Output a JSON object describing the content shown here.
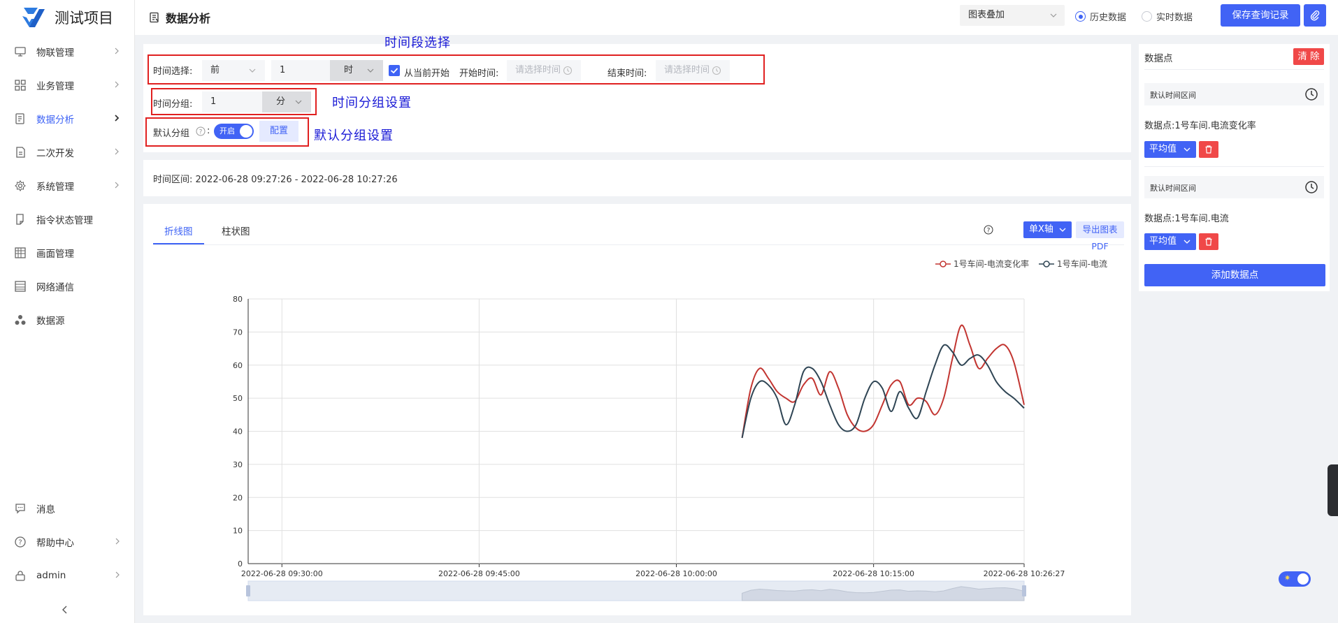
{
  "app": {
    "title": "测试项目"
  },
  "sidebar": {
    "items": [
      {
        "label": "物联管理",
        "icon": "monitor-icon"
      },
      {
        "label": "业务管理",
        "icon": "grid-icon"
      },
      {
        "label": "数据分析",
        "icon": "analysis-icon"
      },
      {
        "label": "二次开发",
        "icon": "dev-icon"
      },
      {
        "label": "系统管理",
        "icon": "gear-icon"
      },
      {
        "label": "指令状态管理",
        "icon": "command-icon"
      },
      {
        "label": "画面管理",
        "icon": "screen-icon"
      },
      {
        "label": "网络通信",
        "icon": "network-icon"
      },
      {
        "label": "数据源",
        "icon": "datasource-icon"
      }
    ],
    "bottom": [
      {
        "label": "消息",
        "icon": "message-icon"
      },
      {
        "label": "帮助中心",
        "icon": "help-icon"
      },
      {
        "label": "admin",
        "icon": "user-icon"
      }
    ]
  },
  "header": {
    "title": "数据分析",
    "overlay_select": "图表叠加",
    "radio_history": "历史数据",
    "radio_realtime": "实时数据",
    "save_button": "保存查询记录"
  },
  "filter": {
    "time_select_label": "时间选择:",
    "direction": "前",
    "amount": "1",
    "unit": "时",
    "from_now_label": "从当前开始",
    "start_label": "开始时间:",
    "start_placeholder": "请选择时间",
    "end_label": "结束时间:",
    "end_placeholder": "请选择时间",
    "group_label": "时间分组:",
    "group_amount": "1",
    "group_unit": "分",
    "default_group_label": "默认分组",
    "default_group_colon": ":",
    "toggle_label": "开启",
    "config_button": "配置"
  },
  "annotations": {
    "range": "时间段选择",
    "group": "时间分组设置",
    "default_group": "默认分组设置"
  },
  "range": {
    "label": "时间区间:",
    "value": "2022-06-28 09:27:26 - 2022-06-28 10:27:26"
  },
  "chart_panel": {
    "tab_line": "折线图",
    "tab_bar": "柱状图",
    "axis_button": "单X轴",
    "export_button": "导出图表PDF"
  },
  "chart_data": {
    "type": "line",
    "series": [
      {
        "name": "1号车间-电流变化率",
        "color": "#c23531",
        "x": [
          "10:05",
          "10:05:40",
          "10:06:20",
          "10:07",
          "10:07:40",
          "10:08:20",
          "10:09",
          "10:09:40",
          "10:10:20",
          "10:11",
          "10:11:40",
          "10:12:20",
          "10:13",
          "10:13:40",
          "10:14:20",
          "10:15",
          "10:15:40",
          "10:16:20",
          "10:17",
          "10:17:40",
          "10:18:20",
          "10:19",
          "10:19:40",
          "10:20:20",
          "10:21",
          "10:21:40",
          "10:22:20",
          "10:23",
          "10:23:40",
          "10:24:20",
          "10:25",
          "10:25:40",
          "10:26:27"
        ],
        "y": [
          38,
          53,
          59,
          56,
          52,
          50,
          49,
          54,
          56,
          51,
          58,
          53,
          45,
          41,
          40,
          42,
          48,
          54,
          55,
          48,
          50,
          49,
          45,
          50,
          62,
          72,
          66,
          59,
          62,
          65,
          66,
          61,
          48
        ]
      },
      {
        "name": "1号车间-电流",
        "color": "#2f4554",
        "x": [
          "10:05",
          "10:05:40",
          "10:06:20",
          "10:07",
          "10:07:40",
          "10:08:20",
          "10:09",
          "10:09:40",
          "10:10:20",
          "10:11",
          "10:11:40",
          "10:12:20",
          "10:13",
          "10:13:40",
          "10:14:20",
          "10:15",
          "10:15:40",
          "10:16:20",
          "10:17",
          "10:17:40",
          "10:18:20",
          "10:19",
          "10:19:40",
          "10:20:20",
          "10:21",
          "10:21:40",
          "10:22:20",
          "10:23",
          "10:23:40",
          "10:24:20",
          "10:25",
          "10:25:40",
          "10:26:27"
        ],
        "y": [
          38,
          50,
          55,
          54,
          50,
          42,
          48,
          58,
          59,
          55,
          48,
          42,
          40,
          42,
          50,
          55,
          53,
          46,
          52,
          47,
          44,
          52,
          60,
          66,
          64,
          60,
          62,
          63,
          60,
          55,
          52,
          50,
          47
        ]
      }
    ],
    "x_ticks": [
      "2022-06-28 09:30:00",
      "2022-06-28 09:45:00",
      "2022-06-28 10:00:00",
      "2022-06-28 10:15:00",
      "2022-06-28 10:26:27"
    ],
    "y_ticks": [
      "0",
      "10",
      "20",
      "30",
      "40",
      "50",
      "60",
      "70",
      "80"
    ],
    "ylim": [
      0,
      80
    ],
    "grid": true,
    "legend": "top-right"
  },
  "right_panel": {
    "title": "数据点",
    "clear_button": "清 除",
    "points": [
      {
        "interval": "默认时间区间",
        "name": "数据点:1号车间.电流变化率",
        "agg": "平均值"
      },
      {
        "interval": "默认时间区间",
        "name": "数据点:1号车间.电流",
        "agg": "平均值"
      }
    ],
    "add_button": "添加数据点"
  },
  "colors": {
    "accent": "#4163f5",
    "danger": "#f04848",
    "annotation": "#1a1ad6",
    "highlight_box": "#e02020"
  }
}
